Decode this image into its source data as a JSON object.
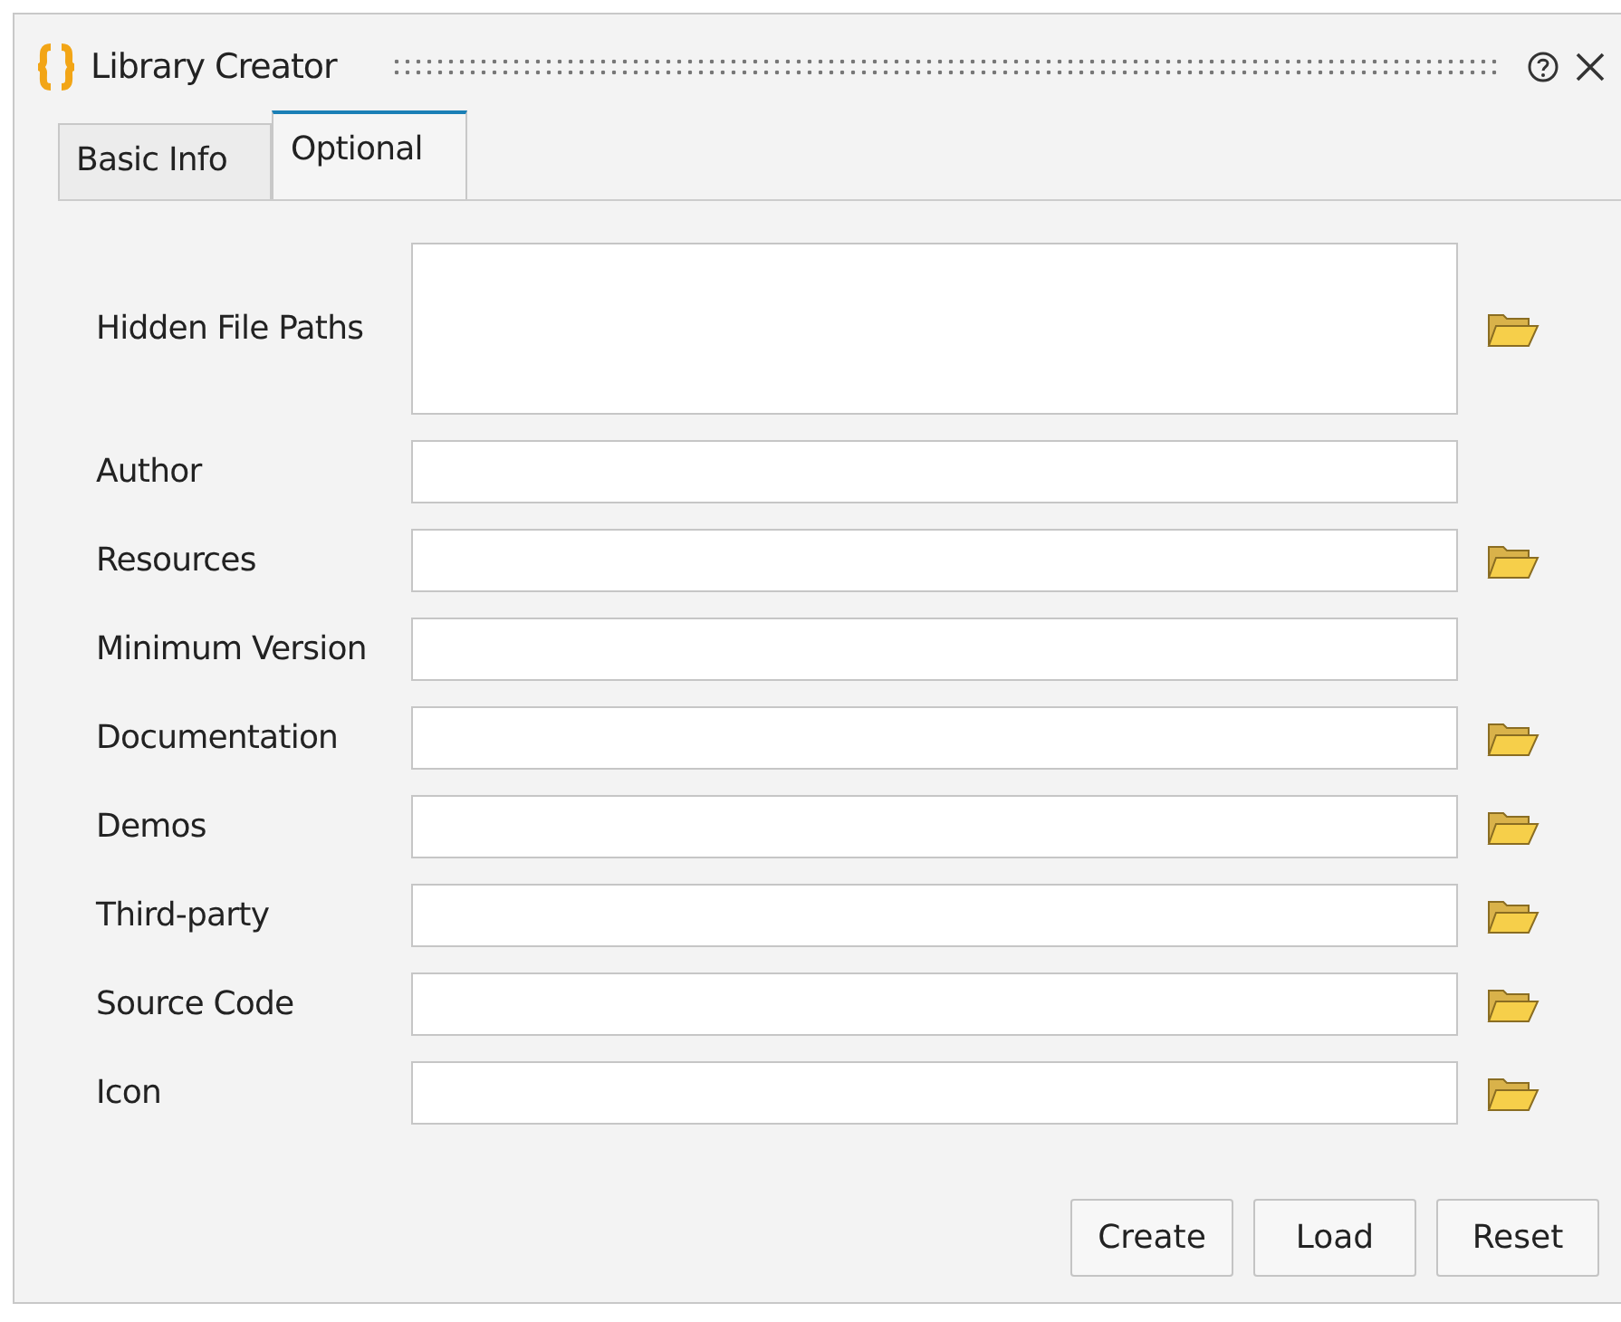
{
  "window": {
    "title": "Library Creator"
  },
  "tabs": [
    {
      "label": "Basic Info",
      "selected": false
    },
    {
      "label": "Optional",
      "selected": true
    }
  ],
  "fields": [
    {
      "label": "Hidden File Paths",
      "kind": "multiline",
      "browse": true
    },
    {
      "label": "Author",
      "kind": "line",
      "browse": false
    },
    {
      "label": "Resources",
      "kind": "line",
      "browse": true
    },
    {
      "label": "Minimum Version",
      "kind": "line",
      "browse": false
    },
    {
      "label": "Documentation",
      "kind": "line",
      "browse": true
    },
    {
      "label": "Demos",
      "kind": "line",
      "browse": true
    },
    {
      "label": "Third-party",
      "kind": "line",
      "browse": true
    },
    {
      "label": "Source Code",
      "kind": "line",
      "browse": true
    },
    {
      "label": "Icon",
      "kind": "line",
      "browse": true
    }
  ],
  "buttons": [
    "Create",
    "Load",
    "Reset"
  ]
}
